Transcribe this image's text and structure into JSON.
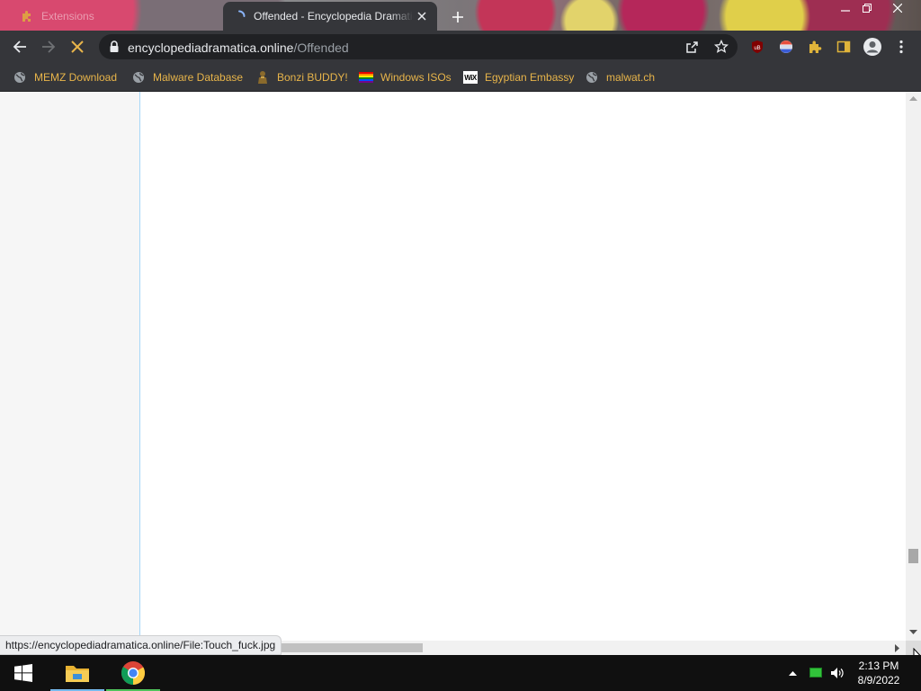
{
  "window": {
    "tabs": [
      {
        "title": "Extensions",
        "active": false
      },
      {
        "title": "Offended - Encyclopedia Dramatica",
        "active": true
      }
    ]
  },
  "toolbar": {
    "url_host": "encyclopediadramatica.online",
    "url_path": "/Offended"
  },
  "bookmarks": [
    {
      "label": "MEMZ Download",
      "icon": "globe-icon"
    },
    {
      "label": "Malware Database",
      "icon": "globe-icon"
    },
    {
      "label": "Bonzi BUDDY!",
      "icon": "bonzi-icon"
    },
    {
      "label": "Windows ISOs",
      "icon": "rainbow-flag-icon"
    },
    {
      "label": "Egyptian Embassy",
      "icon": "wix-icon",
      "icon_text": "WiX"
    },
    {
      "label": "malwat.ch",
      "icon": "globe-icon"
    }
  ],
  "page": {
    "status_url": "https://encyclopediadramatica.online/File:Touch_fuck.jpg"
  },
  "taskbar": {
    "time": "2:13 PM",
    "date": "8/9/2022"
  },
  "colors": {
    "toolbar_bg": "#35363a",
    "omnibox_bg": "#202124",
    "bookmark_text": "#e8b54a",
    "taskbar_bg": "#101010",
    "accent_blue": "#76b9ed"
  }
}
